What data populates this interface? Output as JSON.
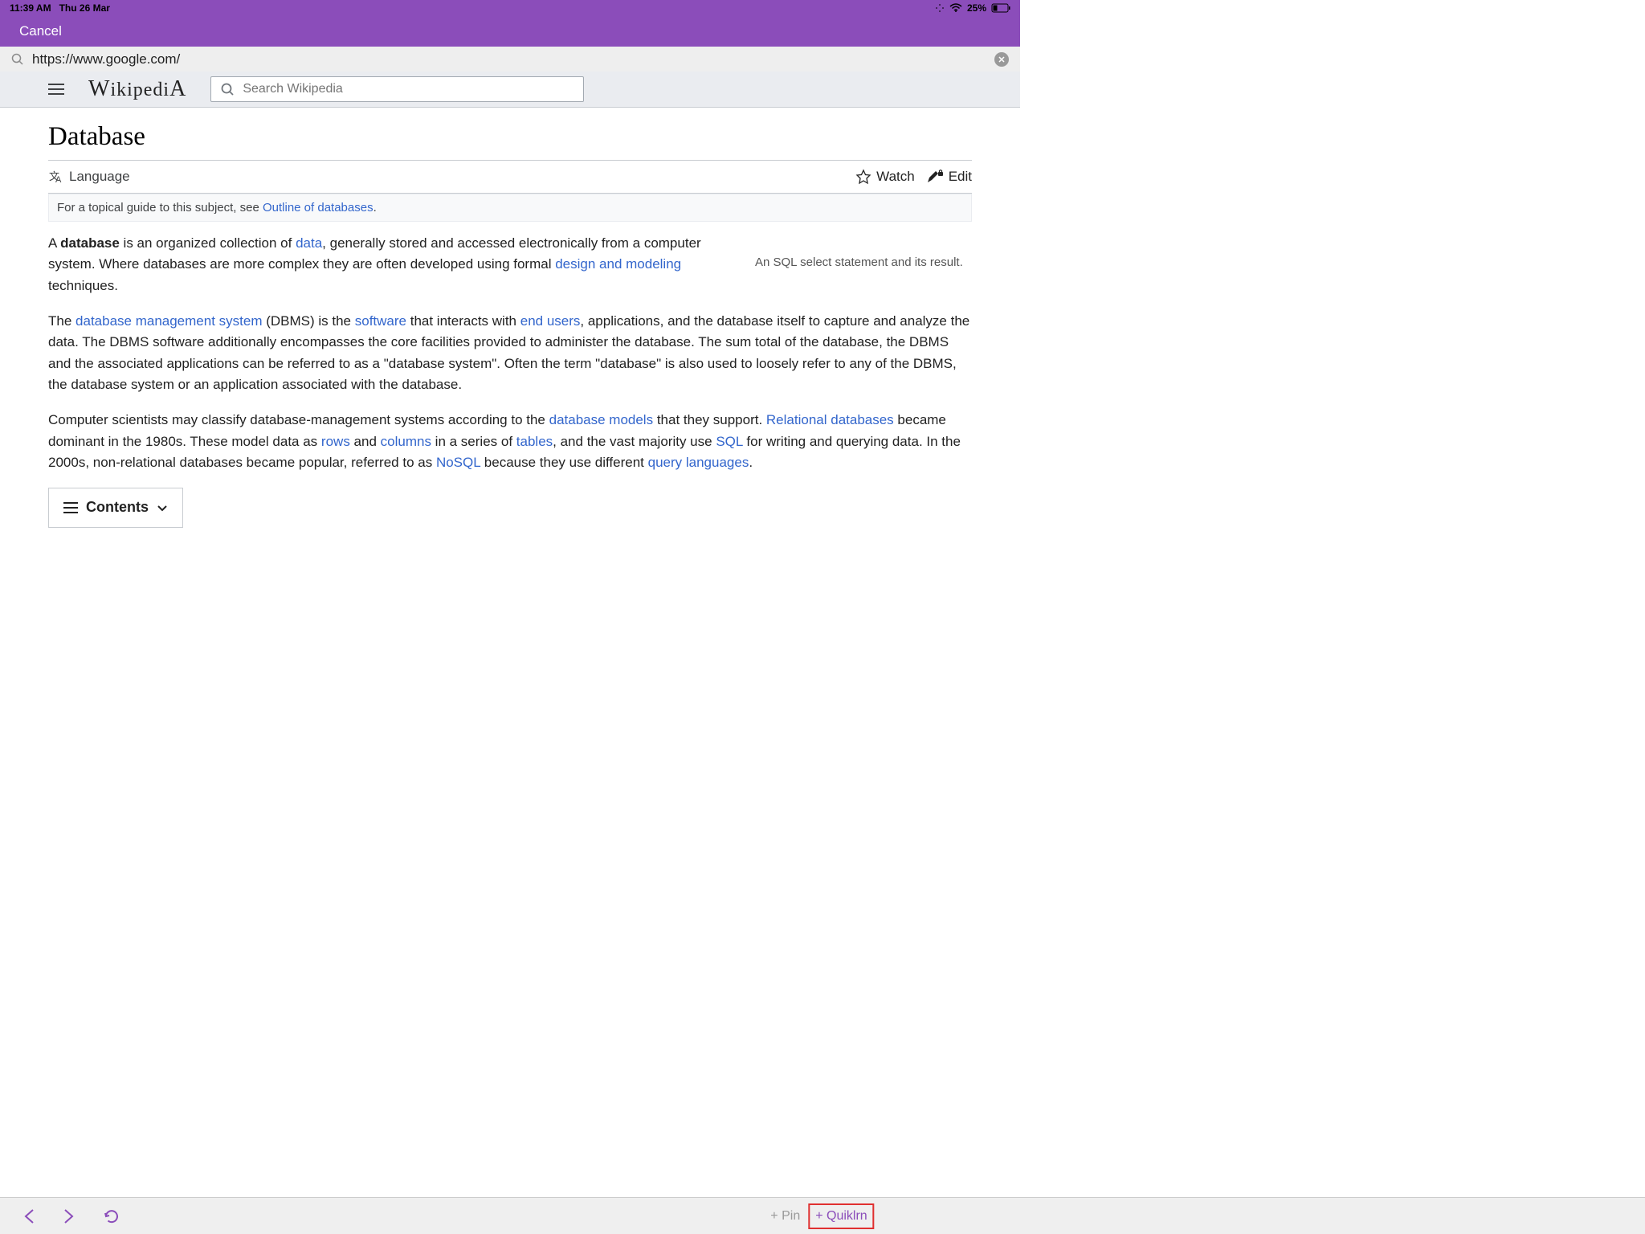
{
  "status": {
    "time": "11:39 AM",
    "date": "Thu 26 Mar",
    "battery": "25%"
  },
  "topbar": {
    "cancel": "Cancel"
  },
  "url": {
    "value": "https://www.google.com/"
  },
  "wiki": {
    "logo": "WIKIPEDIA",
    "search_placeholder": "Search Wikipedia"
  },
  "page": {
    "title": "Database",
    "language": "Language",
    "watch": "Watch",
    "edit": "Edit",
    "hatnote_prefix": "For a topical guide to this subject, see ",
    "hatnote_link": "Outline of databases",
    "hatnote_suffix": ".",
    "side_caption": "An SQL select statement and its result.",
    "contents": "Contents"
  },
  "p1": {
    "t1": "A ",
    "bold": "database",
    "t2": " is an organized collection of ",
    "link1": "data",
    "t3": ", generally stored and accessed electronically from a computer system. Where databases are more complex they are often developed using formal ",
    "link2": "design and modeling",
    "t4": " techniques."
  },
  "p2": {
    "t1": "The ",
    "link1": "database management system",
    "t2": " (DBMS) is the ",
    "link2": "software",
    "t3": " that interacts with ",
    "link3": "end users",
    "t4": ", applications, and the database itself to capture and analyze the data. The DBMS software additionally encompasses the core facilities provided to administer the database. The sum total of the database, the DBMS and the associated applications can be referred to as a \"database system\". Often the term \"database\" is also used to loosely refer to any of the DBMS, the database system or an application associated with the database."
  },
  "p3": {
    "t1": "Computer scientists may classify database-management systems according to the ",
    "link1": "database models",
    "t2": " that they support. ",
    "link2": "Relational databases",
    "t3": " became dominant in the 1980s. These model data as ",
    "link3": "rows",
    "t4": " and ",
    "link4": "columns",
    "t5": " in a series of ",
    "link5": "tables",
    "t6": ", and the vast majority use ",
    "link6": "SQL",
    "t7": " for writing and querying data. In the 2000s, non-relational databases became popular, referred to as ",
    "link7": "NoSQL",
    "t8": " because they use different ",
    "link8": "query languages",
    "t9": "."
  },
  "bottom": {
    "pin": "+ Pin",
    "quiklrn": "+ Quiklrn"
  }
}
